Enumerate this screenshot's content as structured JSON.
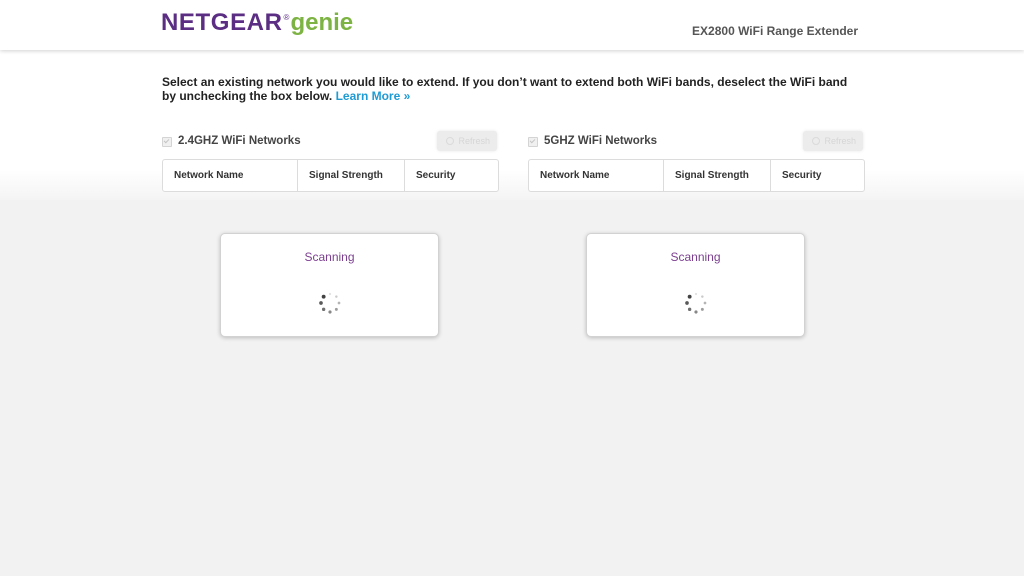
{
  "header": {
    "logo_brand": "NETGEAR",
    "logo_registered": "®",
    "logo_product": "genie",
    "product_name": "EX2800 WiFi Range Extender"
  },
  "instructions": {
    "text": "Select an existing network you would like to extend. If you don’t want to extend both WiFi bands, deselect the WiFi band by unchecking the box below.",
    "learn_more_label": "Learn More »"
  },
  "bands": [
    {
      "title": "2.4GHZ WiFi Networks",
      "refresh_label": "Refresh",
      "columns": [
        "Network Name",
        "Signal Strength",
        "Security"
      ],
      "status": "Scanning"
    },
    {
      "title": "5GHZ WiFi Networks",
      "refresh_label": "Refresh",
      "columns": [
        "Network Name",
        "Signal Strength",
        "Security"
      ],
      "status": "Scanning"
    }
  ],
  "colors": {
    "brand_purple": "#5b2d83",
    "brand_green": "#7cb342",
    "link_blue": "#1f9bd4",
    "scanning_text": "#7b3f8f"
  }
}
